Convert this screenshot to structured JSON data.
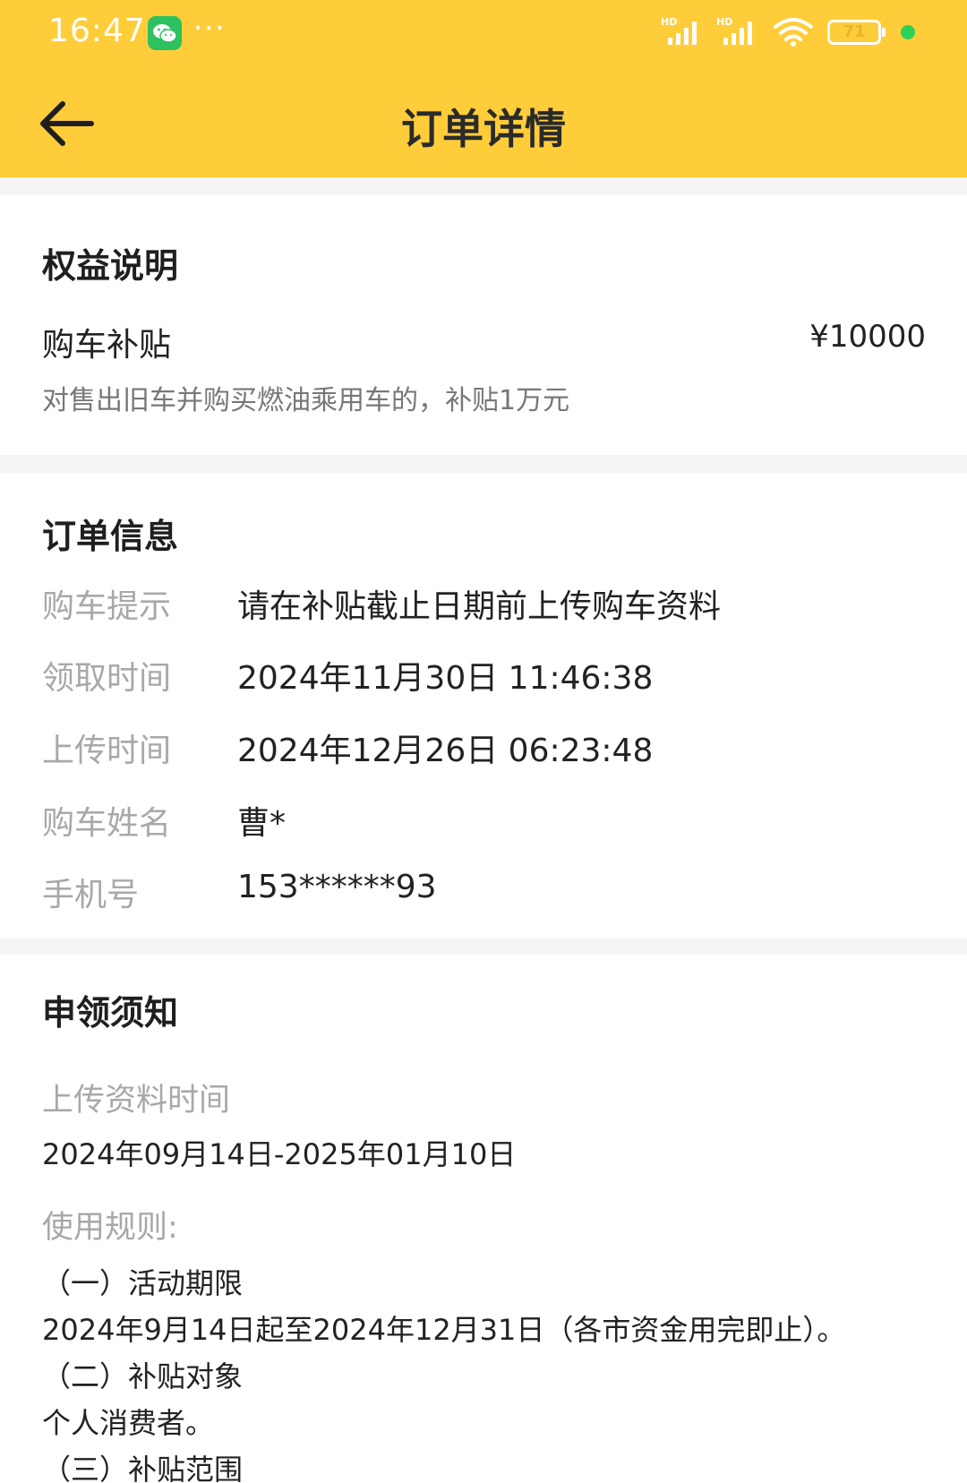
{
  "status_bar": {
    "time": "16:47",
    "more": "···",
    "battery": "71",
    "battery_fraction": 0.71
  },
  "header": {
    "title": "订单详情",
    "back_icon": "arrow-left-icon"
  },
  "benefit": {
    "title": "权益说明",
    "name": "购车补贴",
    "amount": "¥10000",
    "description": "对售出旧车并购买燃油乘用车的，补贴1万元"
  },
  "order": {
    "title": "订单信息",
    "rows": [
      {
        "label": "购车提示",
        "value": "请在补贴截止日期前上传购车资料"
      },
      {
        "label": "领取时间",
        "value": "2024年11月30日 11:46:38"
      },
      {
        "label": "上传时间",
        "value": "2024年12月26日 06:23:48"
      },
      {
        "label": "购车姓名",
        "value": "曹*"
      },
      {
        "label": "手机号",
        "value": "153******93"
      }
    ]
  },
  "notice": {
    "title": "申领须知",
    "upload_label": "上传资料时间",
    "upload_period": "2024年09月14日-2025年01月10日",
    "rules_label": "使用规则:",
    "rules": [
      "（一）活动期限",
      "2024年9月14日起至2024年12月31日（各市资金用完即止）。",
      "（二）补贴对象",
      "个人消费者。",
      "（三）补贴范围"
    ]
  },
  "colors": {
    "header_bg": "#ffcd3a",
    "wechat_green": "#2dc160",
    "indicator_green": "#2ed158"
  }
}
